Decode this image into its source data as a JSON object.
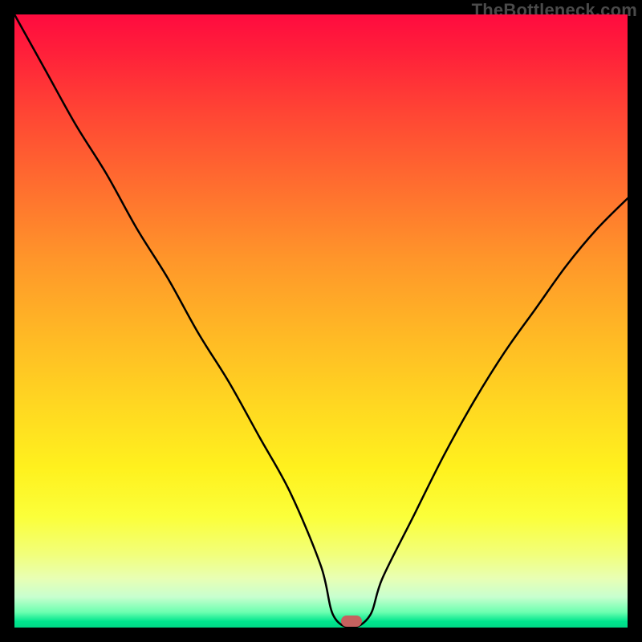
{
  "watermark": "TheBottleneck.com",
  "marker": {
    "x_pct": 55,
    "y_pct": 99.0,
    "color": "#c5615e"
  },
  "chart_data": {
    "type": "line",
    "title": "",
    "xlabel": "",
    "ylabel": "",
    "xlim": [
      0,
      100
    ],
    "ylim": [
      0,
      100
    ],
    "grid": false,
    "series": [
      {
        "name": "bottleneck-curve",
        "x": [
          0,
          5,
          10,
          15,
          20,
          25,
          30,
          35,
          40,
          45,
          50,
          52,
          55,
          58,
          60,
          65,
          70,
          75,
          80,
          85,
          90,
          95,
          100
        ],
        "y": [
          100,
          91,
          82,
          74,
          65,
          57,
          48,
          40,
          31,
          22,
          10,
          2,
          0,
          2,
          8,
          18,
          28,
          37,
          45,
          52,
          59,
          65,
          70
        ]
      }
    ],
    "background_gradient": {
      "orientation": "vertical",
      "stops": [
        {
          "pct": 0,
          "color": "#ff0b3f"
        },
        {
          "pct": 6,
          "color": "#ff1f3a"
        },
        {
          "pct": 16,
          "color": "#ff4534"
        },
        {
          "pct": 28,
          "color": "#ff6e2f"
        },
        {
          "pct": 40,
          "color": "#ff962a"
        },
        {
          "pct": 52,
          "color": "#ffb825"
        },
        {
          "pct": 64,
          "color": "#ffd821"
        },
        {
          "pct": 74,
          "color": "#fff11e"
        },
        {
          "pct": 82,
          "color": "#fbff3a"
        },
        {
          "pct": 88,
          "color": "#f2ff7a"
        },
        {
          "pct": 92,
          "color": "#e8ffb4"
        },
        {
          "pct": 95,
          "color": "#c8ffcf"
        },
        {
          "pct": 97.5,
          "color": "#6cffb0"
        },
        {
          "pct": 99,
          "color": "#00e58d"
        },
        {
          "pct": 100,
          "color": "#00d886"
        }
      ]
    },
    "annotations": [
      {
        "type": "marker",
        "shape": "pill",
        "x": 55,
        "y": 0,
        "color": "#c5615e"
      }
    ]
  }
}
